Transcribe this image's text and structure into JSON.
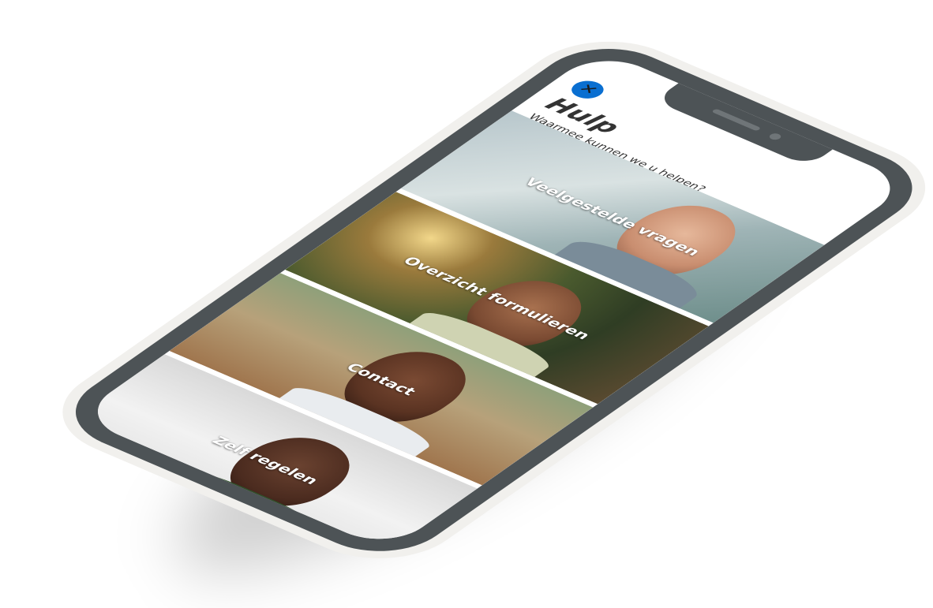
{
  "header": {
    "close_icon": "close-icon",
    "title": "Hulp",
    "subtitle": "Waarmee kunnen we u helpen?"
  },
  "cards": [
    {
      "label": "Veelgestelde vragen"
    },
    {
      "label": "Overzicht formulieren"
    },
    {
      "label": "Contact"
    },
    {
      "label": "Zelf regelen"
    }
  ],
  "colors": {
    "accent": "#0a6fd1",
    "bezel": "#4d5356",
    "frame": "#f1f0ed"
  }
}
